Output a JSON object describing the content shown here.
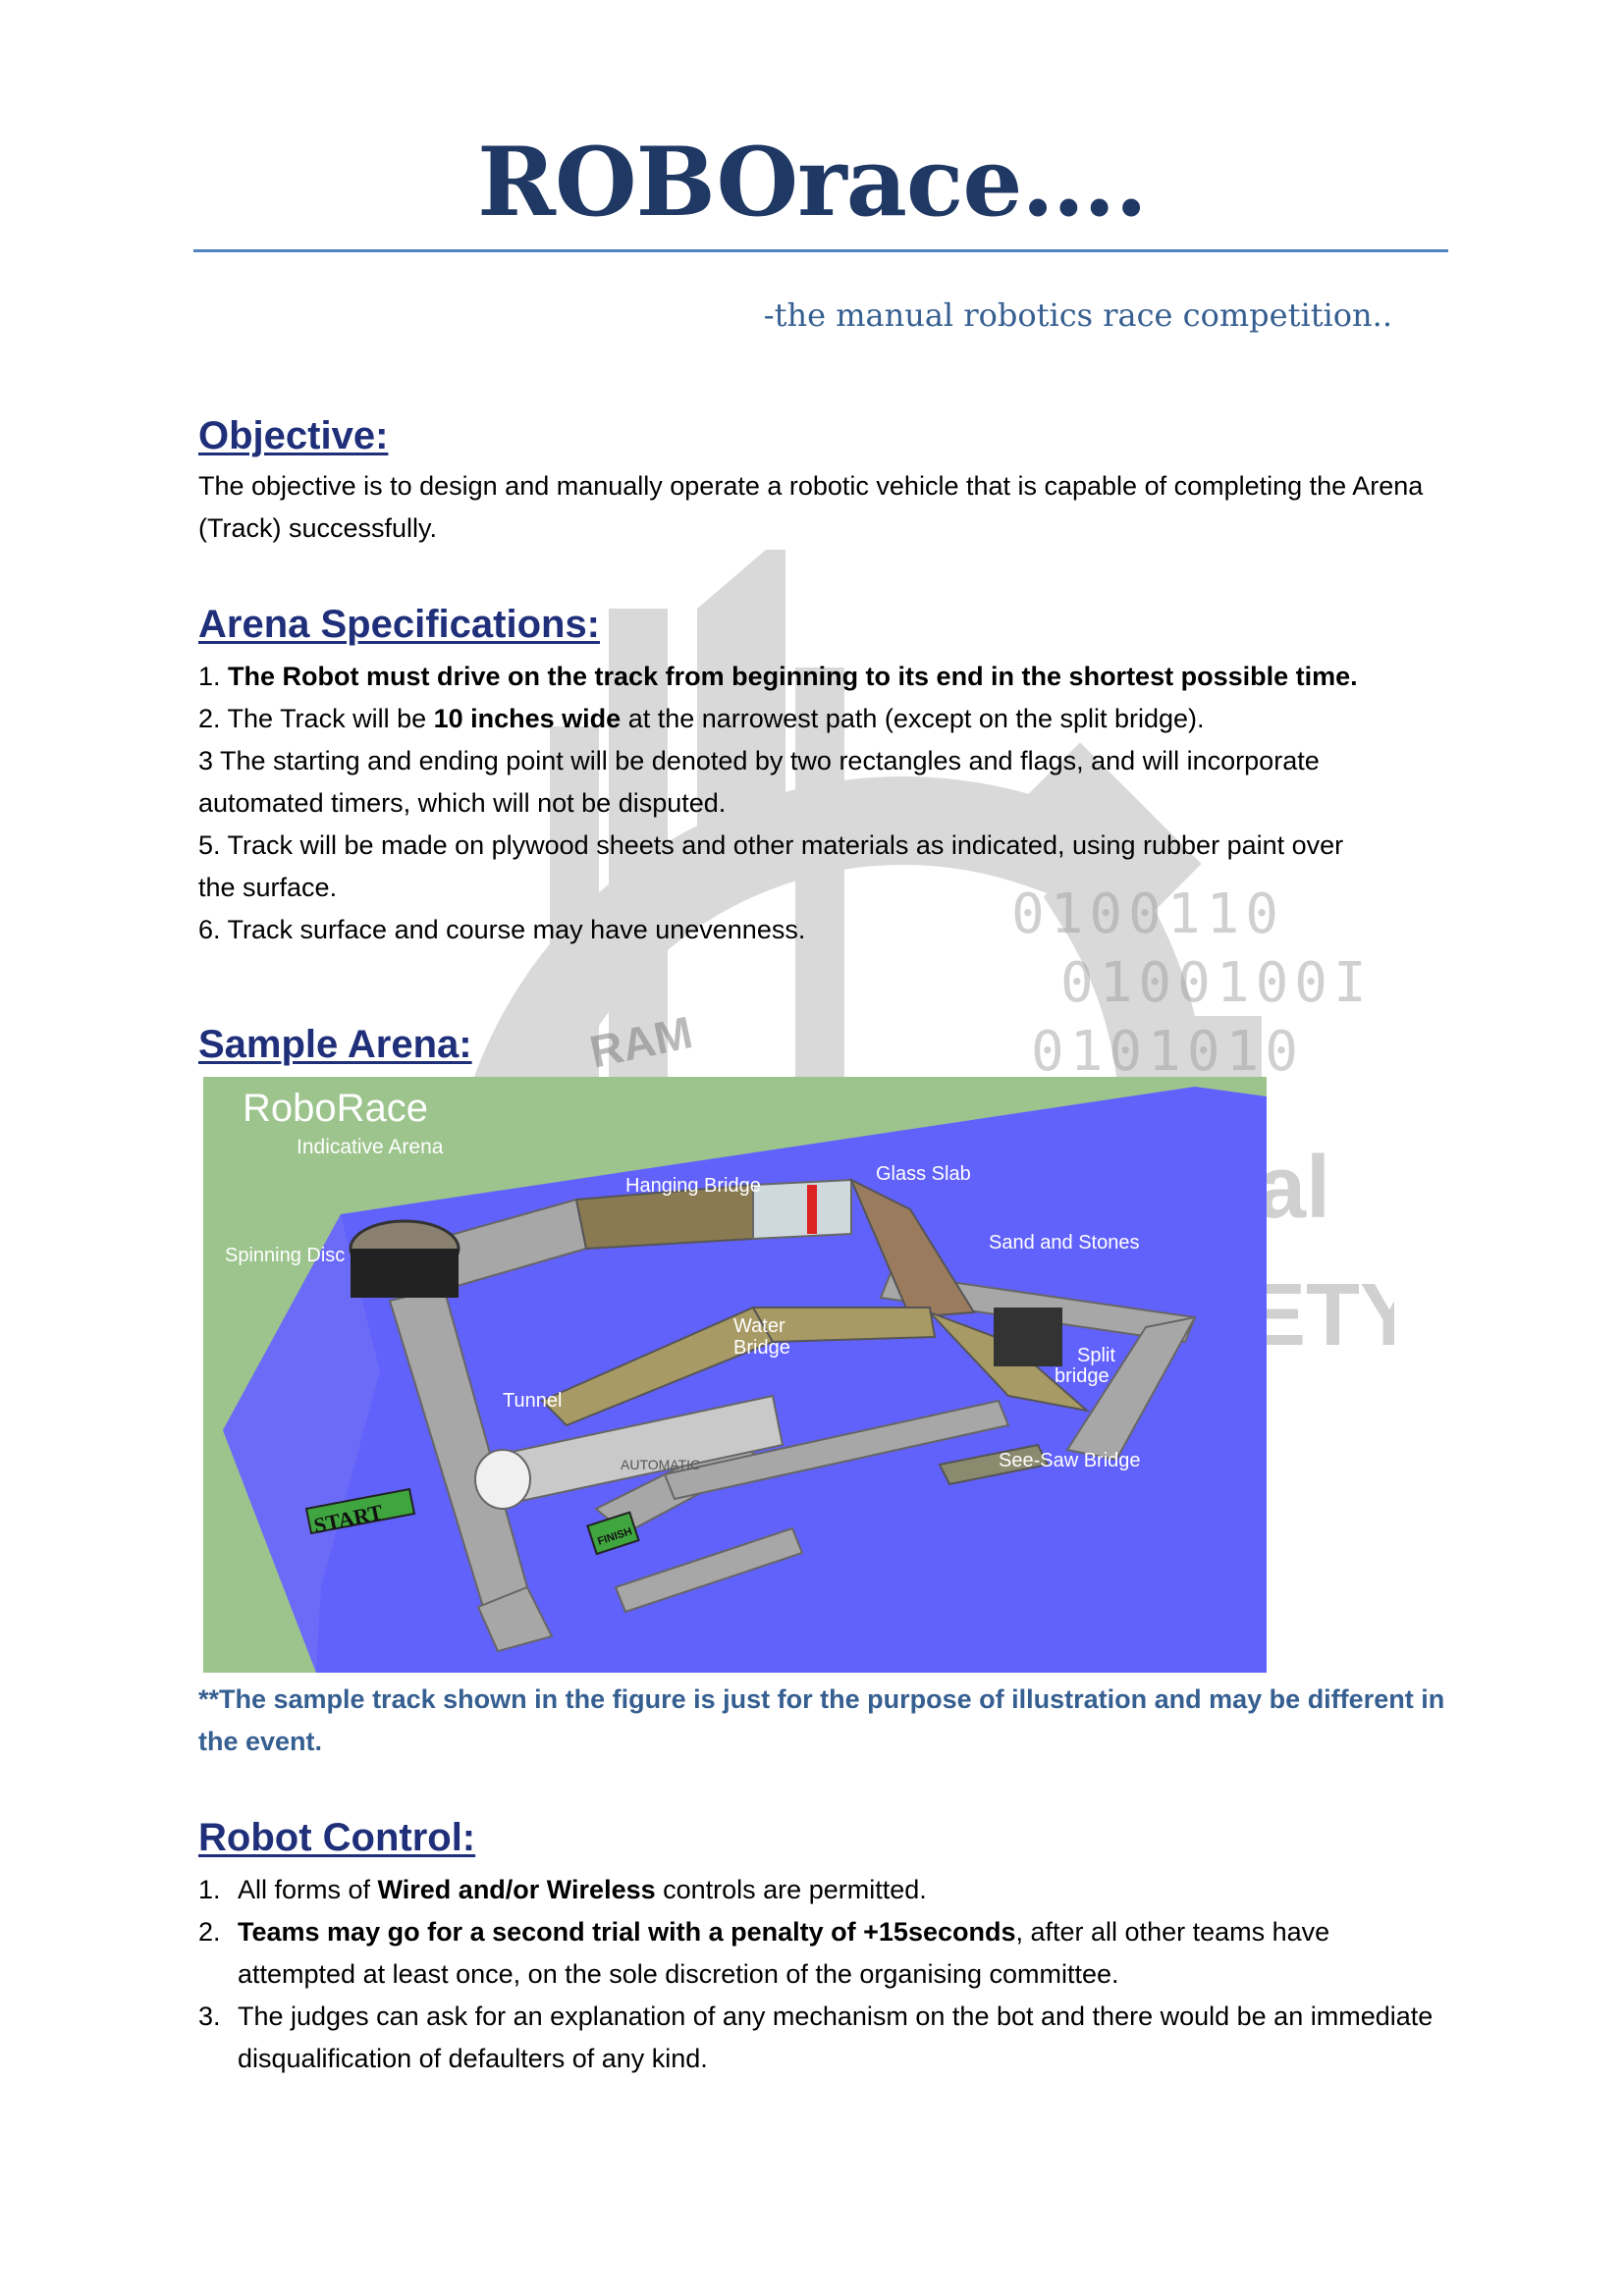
{
  "header": {
    "title": "ROBOrace….",
    "subtitle": "-the manual robotics race competition.."
  },
  "objective": {
    "heading": "Objective:",
    "text": "The objective is to design and manually operate a robotic vehicle that is capable of completing the Arena (Track) successfully."
  },
  "arena_specs": {
    "heading": "Arena Specifications:",
    "items": [
      {
        "prefix": "1. ",
        "bold": "The Robot must drive on the track from beginning to its end in the shortest possible time.",
        "rest": ""
      },
      {
        "prefix": "2. The Track will be ",
        "bold": "10 inches wide",
        "rest": " at the narrowest path (except on the split bridge)."
      },
      {
        "line1": "3 The starting and ending point will be denoted by two rectangles and flags, and will incorporate",
        "line2": "automated timers, which will not be disputed."
      },
      {
        "line1": "5. Track will be made on plywood sheets and other materials as indicated, using rubber paint over",
        "line2": "the surface."
      },
      {
        "text": "6. Track surface and course may have unevenness."
      }
    ]
  },
  "sample_arena": {
    "heading": "Sample Arena:",
    "image": {
      "title": "RoboRace",
      "subtitle": "Indicative Arena",
      "labels": {
        "hanging_bridge": "Hanging Bridge",
        "glass_slab": "Glass Slab",
        "sand_and_stones": "Sand and Stones",
        "spinning_disc": "Spinning Disc",
        "water_bridge_1": "Water",
        "water_bridge_2": "Bridge",
        "split_bridge_1": "Split",
        "split_bridge_2": "bridge",
        "tunnel": "Tunnel",
        "automatic": "AUTOMATIC",
        "see_saw_bridge": "See-Saw Bridge",
        "start": "START",
        "finish": "FINISH"
      }
    },
    "note": "**The sample track shown in the figure is just for the purpose of illustration and may be different in the event."
  },
  "robot_control": {
    "heading": "Robot Control:",
    "items": [
      {
        "num": "1.",
        "pre": "All forms of ",
        "bold": "Wired and/or Wireless",
        "post": " controls are permitted."
      },
      {
        "num": "2.",
        "pre": "",
        "bold": "Teams may go for a second trial with a penalty of +15seconds",
        "post": ", after all other teams have attempted at least once, on the sole discretion of the organising committee."
      },
      {
        "num": "3.",
        "pre": "The judges can ask for an explanation of any mechanism on the bot and there would be an immediate disqualification of defaulters of any kind.",
        "bold": "",
        "post": ""
      }
    ]
  },
  "watermark": {
    "text": "RAM",
    "binary": [
      "0100110",
      "0100100I",
      "0101010"
    ],
    "fragment_1": "al",
    "fragment_2": "ETY"
  },
  "colors": {
    "title": "#1f3864",
    "heading": "#1f2f7a",
    "subtitle": "#365f91",
    "rule": "#4f81bd",
    "arena_water": "#6161fb",
    "arena_grass": "#9cc48c"
  }
}
